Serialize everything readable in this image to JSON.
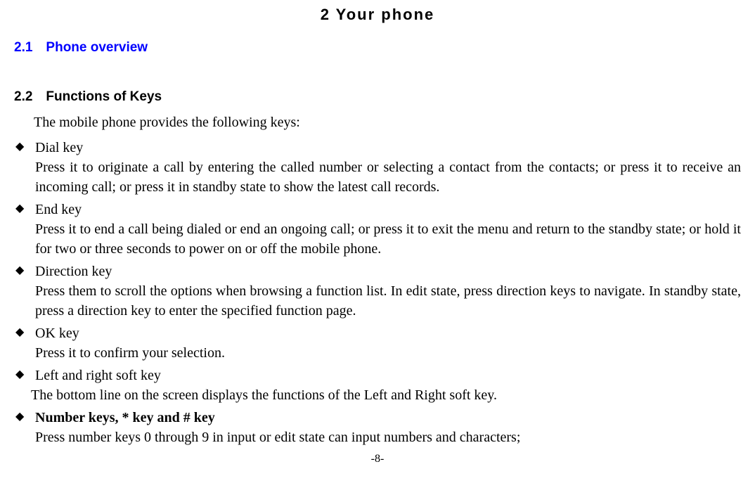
{
  "chapter_title": "2  Your  phone",
  "section_2_1": "2.1 Phone overview",
  "section_2_2": "2.2 Functions of Keys",
  "intro": "The mobile phone provides the following keys:",
  "items": [
    {
      "name": "Dial key",
      "desc": "Press it to originate a call by entering the called number or selecting a contact from the contacts; or press it to receive an incoming call; or press it in standby state to show the latest call records."
    },
    {
      "name": "End key",
      "desc": "Press it to end a call being dialed or end an ongoing call; or press it to exit the menu and return to the standby state; or hold it for two or three seconds to power on or off the mobile phone."
    },
    {
      "name": "Direction key",
      "desc": "Press them to scroll the options when browsing a function list. In edit state, press direction keys to navigate. In standby state, press a direction key to enter the specified function page."
    },
    {
      "name": "OK key",
      "desc": "Press it to confirm your selection."
    },
    {
      "name": "Left and right soft key",
      "desc": "The bottom line on the screen displays the functions of the Left and Right soft key."
    },
    {
      "name": "Number keys, * key and # key",
      "desc": "Press number keys 0 through 9 in input or edit state can input numbers and characters;"
    }
  ],
  "page_number": "-8-"
}
